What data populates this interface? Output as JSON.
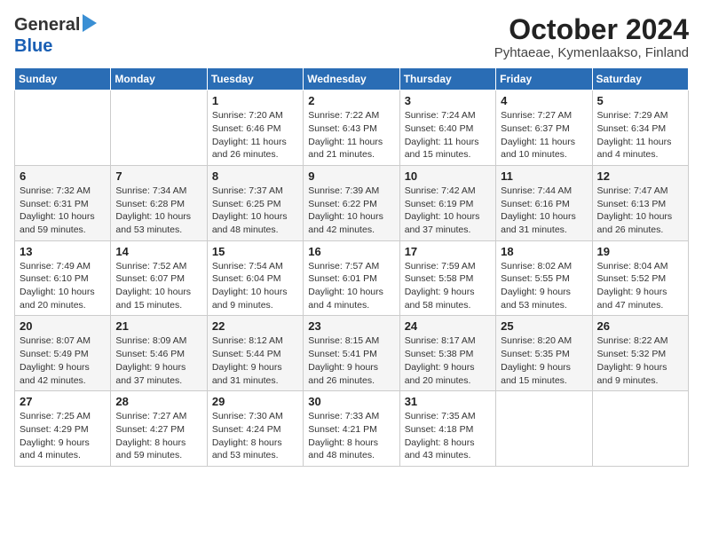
{
  "logo": {
    "general": "General",
    "blue": "Blue"
  },
  "title": "October 2024",
  "subtitle": "Pyhtaeae, Kymenlaakso, Finland",
  "days_of_week": [
    "Sunday",
    "Monday",
    "Tuesday",
    "Wednesday",
    "Thursday",
    "Friday",
    "Saturday"
  ],
  "weeks": [
    [
      {
        "day": "",
        "info": ""
      },
      {
        "day": "",
        "info": ""
      },
      {
        "day": "1",
        "info": "Sunrise: 7:20 AM\nSunset: 6:46 PM\nDaylight: 11 hours\nand 26 minutes."
      },
      {
        "day": "2",
        "info": "Sunrise: 7:22 AM\nSunset: 6:43 PM\nDaylight: 11 hours\nand 21 minutes."
      },
      {
        "day": "3",
        "info": "Sunrise: 7:24 AM\nSunset: 6:40 PM\nDaylight: 11 hours\nand 15 minutes."
      },
      {
        "day": "4",
        "info": "Sunrise: 7:27 AM\nSunset: 6:37 PM\nDaylight: 11 hours\nand 10 minutes."
      },
      {
        "day": "5",
        "info": "Sunrise: 7:29 AM\nSunset: 6:34 PM\nDaylight: 11 hours\nand 4 minutes."
      }
    ],
    [
      {
        "day": "6",
        "info": "Sunrise: 7:32 AM\nSunset: 6:31 PM\nDaylight: 10 hours\nand 59 minutes."
      },
      {
        "day": "7",
        "info": "Sunrise: 7:34 AM\nSunset: 6:28 PM\nDaylight: 10 hours\nand 53 minutes."
      },
      {
        "day": "8",
        "info": "Sunrise: 7:37 AM\nSunset: 6:25 PM\nDaylight: 10 hours\nand 48 minutes."
      },
      {
        "day": "9",
        "info": "Sunrise: 7:39 AM\nSunset: 6:22 PM\nDaylight: 10 hours\nand 42 minutes."
      },
      {
        "day": "10",
        "info": "Sunrise: 7:42 AM\nSunset: 6:19 PM\nDaylight: 10 hours\nand 37 minutes."
      },
      {
        "day": "11",
        "info": "Sunrise: 7:44 AM\nSunset: 6:16 PM\nDaylight: 10 hours\nand 31 minutes."
      },
      {
        "day": "12",
        "info": "Sunrise: 7:47 AM\nSunset: 6:13 PM\nDaylight: 10 hours\nand 26 minutes."
      }
    ],
    [
      {
        "day": "13",
        "info": "Sunrise: 7:49 AM\nSunset: 6:10 PM\nDaylight: 10 hours\nand 20 minutes."
      },
      {
        "day": "14",
        "info": "Sunrise: 7:52 AM\nSunset: 6:07 PM\nDaylight: 10 hours\nand 15 minutes."
      },
      {
        "day": "15",
        "info": "Sunrise: 7:54 AM\nSunset: 6:04 PM\nDaylight: 10 hours\nand 9 minutes."
      },
      {
        "day": "16",
        "info": "Sunrise: 7:57 AM\nSunset: 6:01 PM\nDaylight: 10 hours\nand 4 minutes."
      },
      {
        "day": "17",
        "info": "Sunrise: 7:59 AM\nSunset: 5:58 PM\nDaylight: 9 hours\nand 58 minutes."
      },
      {
        "day": "18",
        "info": "Sunrise: 8:02 AM\nSunset: 5:55 PM\nDaylight: 9 hours\nand 53 minutes."
      },
      {
        "day": "19",
        "info": "Sunrise: 8:04 AM\nSunset: 5:52 PM\nDaylight: 9 hours\nand 47 minutes."
      }
    ],
    [
      {
        "day": "20",
        "info": "Sunrise: 8:07 AM\nSunset: 5:49 PM\nDaylight: 9 hours\nand 42 minutes."
      },
      {
        "day": "21",
        "info": "Sunrise: 8:09 AM\nSunset: 5:46 PM\nDaylight: 9 hours\nand 37 minutes."
      },
      {
        "day": "22",
        "info": "Sunrise: 8:12 AM\nSunset: 5:44 PM\nDaylight: 9 hours\nand 31 minutes."
      },
      {
        "day": "23",
        "info": "Sunrise: 8:15 AM\nSunset: 5:41 PM\nDaylight: 9 hours\nand 26 minutes."
      },
      {
        "day": "24",
        "info": "Sunrise: 8:17 AM\nSunset: 5:38 PM\nDaylight: 9 hours\nand 20 minutes."
      },
      {
        "day": "25",
        "info": "Sunrise: 8:20 AM\nSunset: 5:35 PM\nDaylight: 9 hours\nand 15 minutes."
      },
      {
        "day": "26",
        "info": "Sunrise: 8:22 AM\nSunset: 5:32 PM\nDaylight: 9 hours\nand 9 minutes."
      }
    ],
    [
      {
        "day": "27",
        "info": "Sunrise: 7:25 AM\nSunset: 4:29 PM\nDaylight: 9 hours\nand 4 minutes."
      },
      {
        "day": "28",
        "info": "Sunrise: 7:27 AM\nSunset: 4:27 PM\nDaylight: 8 hours\nand 59 minutes."
      },
      {
        "day": "29",
        "info": "Sunrise: 7:30 AM\nSunset: 4:24 PM\nDaylight: 8 hours\nand 53 minutes."
      },
      {
        "day": "30",
        "info": "Sunrise: 7:33 AM\nSunset: 4:21 PM\nDaylight: 8 hours\nand 48 minutes."
      },
      {
        "day": "31",
        "info": "Sunrise: 7:35 AM\nSunset: 4:18 PM\nDaylight: 8 hours\nand 43 minutes."
      },
      {
        "day": "",
        "info": ""
      },
      {
        "day": "",
        "info": ""
      }
    ]
  ]
}
